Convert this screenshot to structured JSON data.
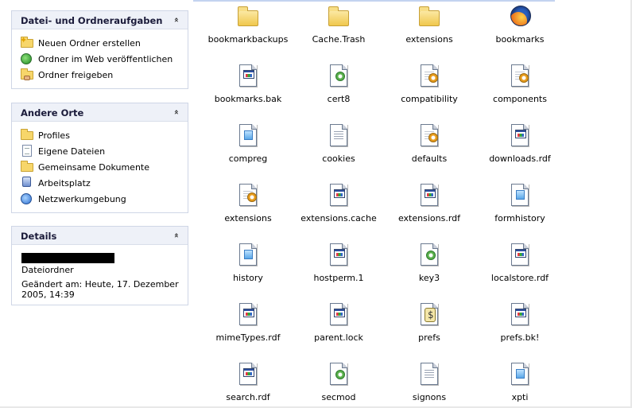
{
  "tasks_pane": {
    "title": "Datei- und Ordneraufgaben",
    "collapse_glyph": "«",
    "items": [
      {
        "label": "Neuen Ordner erstellen",
        "icon": "new-folder-icon"
      },
      {
        "label": "Ordner im Web veröffentlichen",
        "icon": "web-publish-icon"
      },
      {
        "label": "Ordner freigeben",
        "icon": "share-folder-icon"
      }
    ]
  },
  "places_pane": {
    "title": "Andere Orte",
    "collapse_glyph": "«",
    "items": [
      {
        "label": "Profiles",
        "icon": "folder-icon"
      },
      {
        "label": "Eigene Dateien",
        "icon": "my-documents-icon"
      },
      {
        "label": "Gemeinsame Dokumente",
        "icon": "shared-documents-icon"
      },
      {
        "label": "Arbeitsplatz",
        "icon": "my-computer-icon"
      },
      {
        "label": "Netzwerkumgebung",
        "icon": "network-icon"
      }
    ]
  },
  "details_pane": {
    "title": "Details",
    "collapse_glyph": "«",
    "type": "Dateiordner",
    "modified_line1": "Geändert am: Heute, 17. Dezember",
    "modified_line2": "2005, 14:39"
  },
  "files": [
    {
      "name": "bookmarkbackups",
      "icon": "folder"
    },
    {
      "name": "Cache.Trash",
      "icon": "folder"
    },
    {
      "name": "extensions",
      "icon": "folder"
    },
    {
      "name": "bookmarks",
      "icon": "firefox"
    },
    {
      "name": "bookmarks.bak",
      "icon": "window-doc"
    },
    {
      "name": "cert8",
      "icon": "green-gear-doc"
    },
    {
      "name": "compatibility",
      "icon": "gear-doc"
    },
    {
      "name": "components",
      "icon": "gear-doc"
    },
    {
      "name": "compreg",
      "icon": "blue-doc"
    },
    {
      "name": "cookies",
      "icon": "text-doc"
    },
    {
      "name": "defaults",
      "icon": "gear-doc"
    },
    {
      "name": "downloads.rdf",
      "icon": "window-doc"
    },
    {
      "name": "extensions",
      "icon": "gear-doc"
    },
    {
      "name": "extensions.cache",
      "icon": "window-doc"
    },
    {
      "name": "extensions.rdf",
      "icon": "window-doc"
    },
    {
      "name": "formhistory",
      "icon": "blue-doc"
    },
    {
      "name": "history",
      "icon": "blue-doc"
    },
    {
      "name": "hostperm.1",
      "icon": "window-doc"
    },
    {
      "name": "key3",
      "icon": "green-gear-doc"
    },
    {
      "name": "localstore.rdf",
      "icon": "window-doc"
    },
    {
      "name": "mimeTypes.rdf",
      "icon": "window-doc"
    },
    {
      "name": "parent.lock",
      "icon": "window-doc"
    },
    {
      "name": "prefs",
      "icon": "script-doc"
    },
    {
      "name": "prefs.bk!",
      "icon": "window-doc"
    },
    {
      "name": "search.rdf",
      "icon": "window-doc"
    },
    {
      "name": "secmod",
      "icon": "green-gear-doc"
    },
    {
      "name": "signons",
      "icon": "text-doc"
    },
    {
      "name": "xpti",
      "icon": "blue-doc"
    }
  ]
}
